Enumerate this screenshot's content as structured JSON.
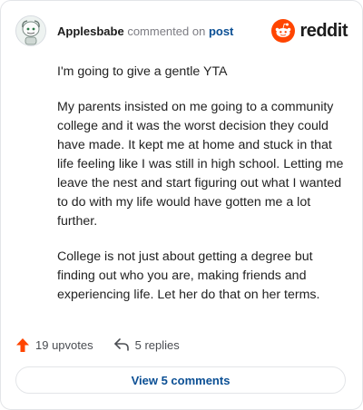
{
  "header": {
    "username": "Applesbabe",
    "action_text": "commented on",
    "post_link": "post",
    "brand": "reddit"
  },
  "comment": {
    "paragraphs": [
      "I'm going to give a gentle YTA",
      "My parents insisted on me going to a community college and it was the worst decision they could have made. It kept me at home and stuck in that life feeling like I was still in high school. Letting me leave the nest and start figuring out what I wanted to do with my life would have gotten me a lot further.",
      "College is not just about getting a degree but finding out who you are, making friends and experiencing life. Let her do that on her terms."
    ]
  },
  "actions": {
    "upvotes": "19 upvotes",
    "replies": "5 replies"
  },
  "footer": {
    "view_comments": "View 5 comments"
  },
  "colors": {
    "upvote": "#ff4500",
    "link": "#0b4f94",
    "brand": "#ff4500"
  },
  "icons": {
    "avatar": "user-avatar-icon",
    "brand": "reddit-snoo-icon",
    "upvote": "upvote-arrow-icon",
    "reply": "reply-arrow-icon"
  }
}
